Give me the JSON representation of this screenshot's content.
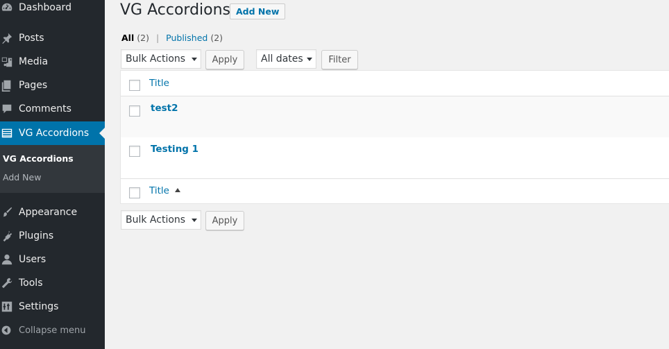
{
  "sidebar": {
    "items": [
      {
        "label": "Dashboard",
        "icon": "dashboard-icon"
      },
      {
        "label": "Posts",
        "icon": "pin-icon"
      },
      {
        "label": "Media",
        "icon": "media-icon"
      },
      {
        "label": "Pages",
        "icon": "pages-icon"
      },
      {
        "label": "Comments",
        "icon": "comment-icon"
      },
      {
        "label": "VG Accordions",
        "icon": "list-icon",
        "active": true
      },
      {
        "label": "Appearance",
        "icon": "brush-icon"
      },
      {
        "label": "Plugins",
        "icon": "plugin-icon"
      },
      {
        "label": "Users",
        "icon": "user-icon"
      },
      {
        "label": "Tools",
        "icon": "wrench-icon"
      },
      {
        "label": "Settings",
        "icon": "settings-icon"
      }
    ],
    "submenu": [
      "VG Accordions",
      "Add New"
    ],
    "collapse_label": "Collapse menu"
  },
  "page": {
    "title": "VG Accordions",
    "add_new_label": "Add New"
  },
  "filters": {
    "all_label": "All",
    "all_count": "(2)",
    "separator": "|",
    "published_label": "Published",
    "published_count": "(2)"
  },
  "toolbar_top": {
    "bulk_actions": "Bulk Actions",
    "apply_label": "Apply",
    "dates": "All dates",
    "filter_label": "Filter"
  },
  "table": {
    "header": "Title",
    "footer": "Title",
    "rows": [
      "test2",
      "Testing 1"
    ]
  },
  "toolbar_bottom": {
    "bulk_actions": "Bulk Actions",
    "apply_label": "Apply"
  },
  "colors": {
    "sidebar_bg": "#23282d",
    "submenu_bg": "#32373c",
    "accent": "#0073aa",
    "page_bg": "#f1f1f1"
  }
}
